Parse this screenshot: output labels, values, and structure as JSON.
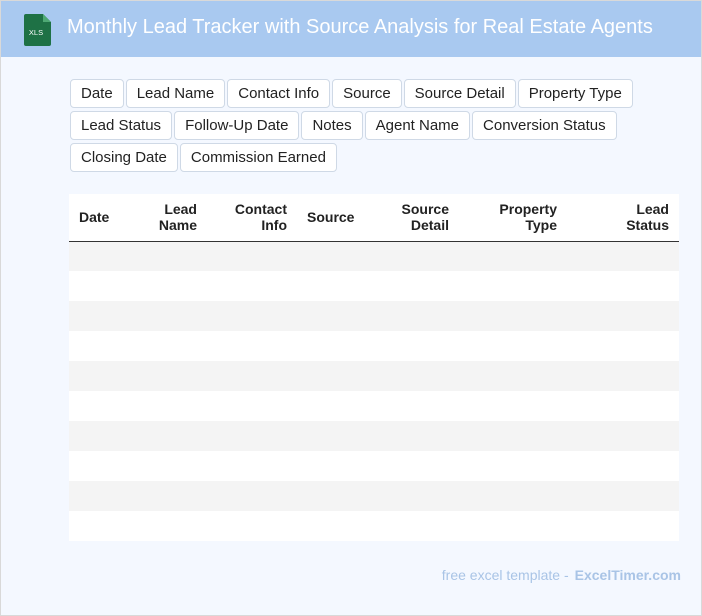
{
  "header": {
    "title": "Monthly Lead Tracker with Source Analysis for Real Estate Agents",
    "file_icon": "xls-file-icon",
    "file_icon_label": "XLS",
    "colors": {
      "header_bg": "#a9c9f0",
      "icon_green": "#1e7145"
    }
  },
  "field_chips": {
    "row1": [
      "Date",
      "Lead Name",
      "Contact Info",
      "Source",
      "Source Detail",
      "Property Type"
    ],
    "row2": [
      "Lead Status",
      "Follow-Up Date",
      "Notes",
      "Agent Name",
      "Conversion Status"
    ],
    "row3": [
      "Closing Date",
      "Commission Earned"
    ]
  },
  "table": {
    "columns": [
      {
        "line1": "Date",
        "line2": ""
      },
      {
        "line1": "Lead",
        "line2": "Name"
      },
      {
        "line1": "Contact",
        "line2": "Info"
      },
      {
        "line1": "Source",
        "line2": ""
      },
      {
        "line1": "Source",
        "line2": "Detail"
      },
      {
        "line1": "Property",
        "line2": "Type"
      },
      {
        "line1": "Lead",
        "line2": "Status"
      }
    ],
    "rows": 10
  },
  "footer": {
    "prefix": "free excel template -",
    "brand": "ExcelTimer.com"
  }
}
